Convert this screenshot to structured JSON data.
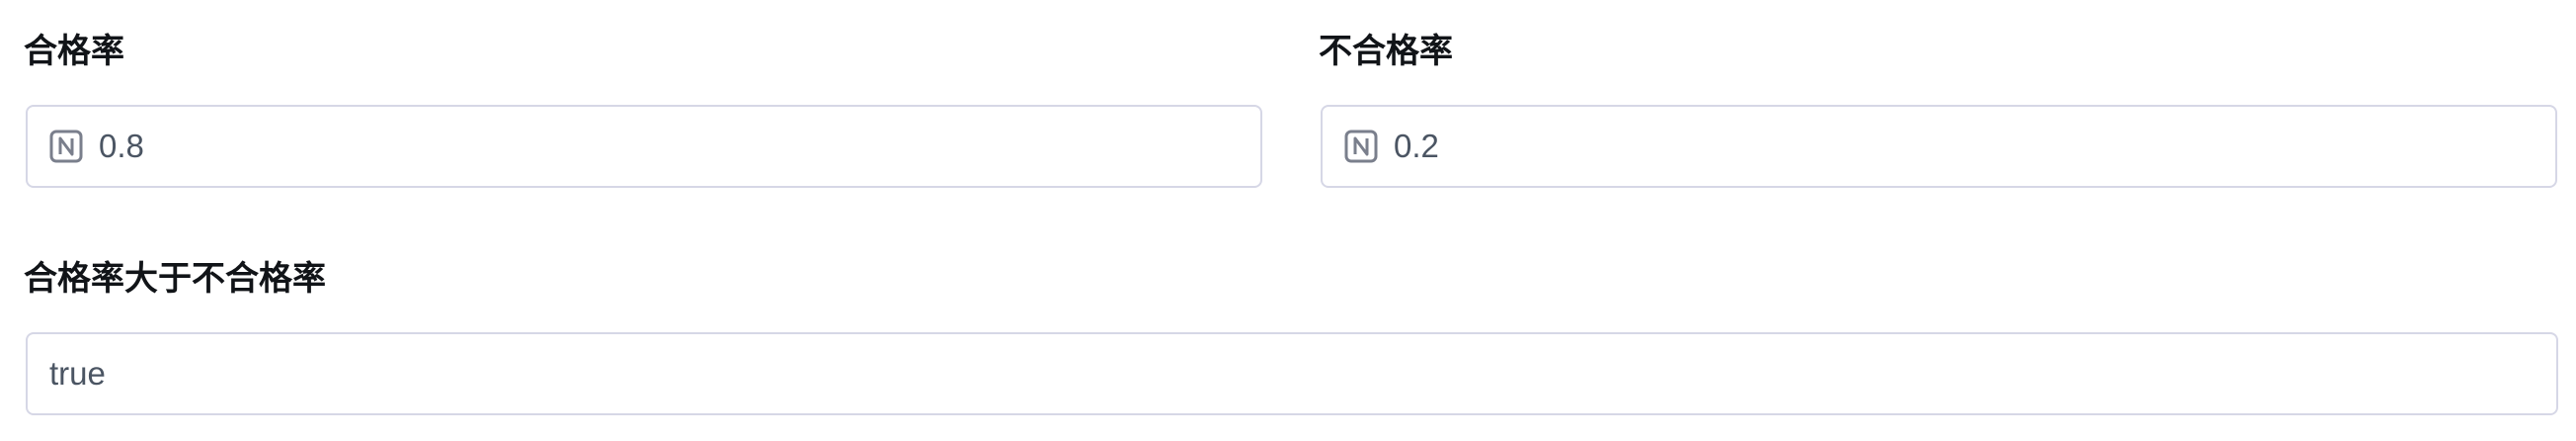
{
  "fields": [
    {
      "label": "合格率",
      "value": "0.8",
      "type_icon": "number-type-icon"
    },
    {
      "label": "不合格率",
      "value": "0.2",
      "type_icon": "number-type-icon"
    },
    {
      "label": "合格率大于不合格率",
      "value": "true"
    }
  ],
  "colors": {
    "label_text": "#111418",
    "value_text": "#4b5563",
    "border": "#d6d7e6",
    "icon": "#7a7f8c"
  }
}
